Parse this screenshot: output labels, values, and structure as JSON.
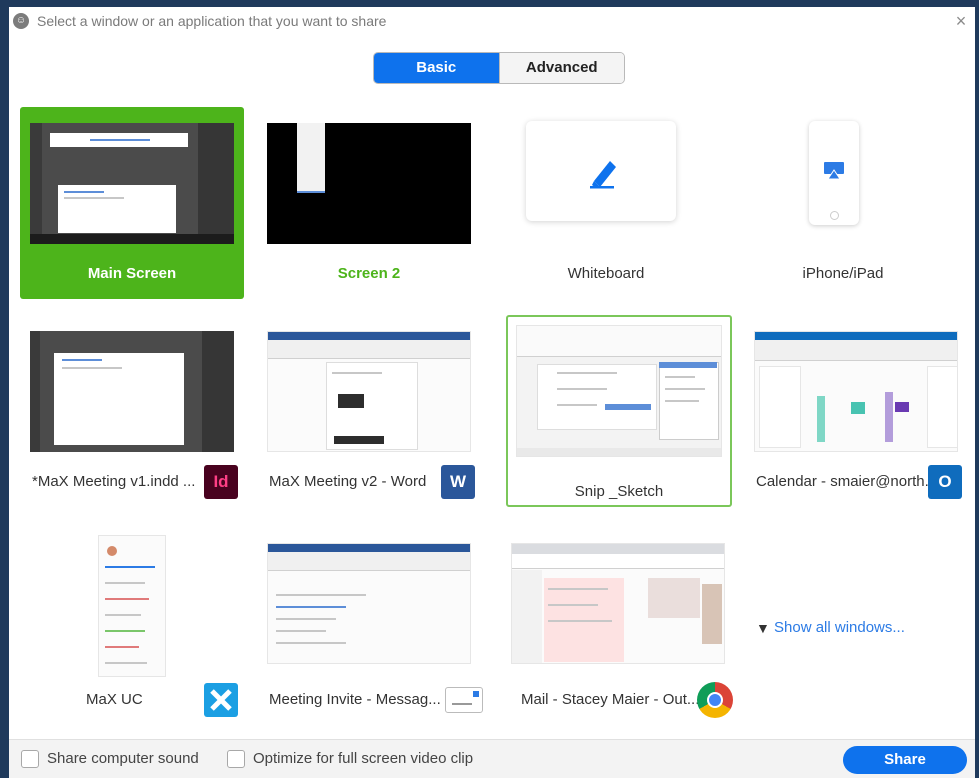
{
  "window": {
    "title": "Select a window or an application that you want to share",
    "close_glyph": "×"
  },
  "tabs": [
    {
      "label": "Basic",
      "active": true
    },
    {
      "label": "Advanced",
      "active": false
    }
  ],
  "tiles": [
    {
      "label": "Main Screen",
      "state": "selected"
    },
    {
      "label": "Screen 2",
      "state": "normal"
    },
    {
      "label": "Whiteboard",
      "state": "normal"
    },
    {
      "label": "iPhone/iPad",
      "state": "normal"
    },
    {
      "label": "*MaX Meeting v1.indd ...",
      "icon": "indesign-icon",
      "icon_text": "Id"
    },
    {
      "label": "MaX Meeting v2 - Word",
      "icon": "word-icon",
      "icon_text": "W"
    },
    {
      "label": "Snip _Sketch",
      "state": "hover"
    },
    {
      "label": "Calendar - smaier@north...",
      "icon": "outlook-icon",
      "icon_text": "O"
    },
    {
      "label": "MaX UC",
      "icon": "max-uc-icon"
    },
    {
      "label": "Meeting Invite - Messag...",
      "icon": "message-icon"
    },
    {
      "label": "Mail - Stacey Maier - Out...",
      "icon": "chrome-icon"
    }
  ],
  "show_all": {
    "label": "Show all windows..."
  },
  "footer": {
    "share_sound_label": "Share computer sound",
    "share_sound_checked": false,
    "optimize_label": "Optimize for full screen video clip",
    "optimize_checked": false,
    "share_button": "Share"
  },
  "colors": {
    "accent_blue": "#0e72ed",
    "selected_green": "#4db41b",
    "indesign": "#e0175f",
    "word": "#2b579a",
    "outlook": "#0f6cbd",
    "max_uc": "#1b9fe3"
  }
}
